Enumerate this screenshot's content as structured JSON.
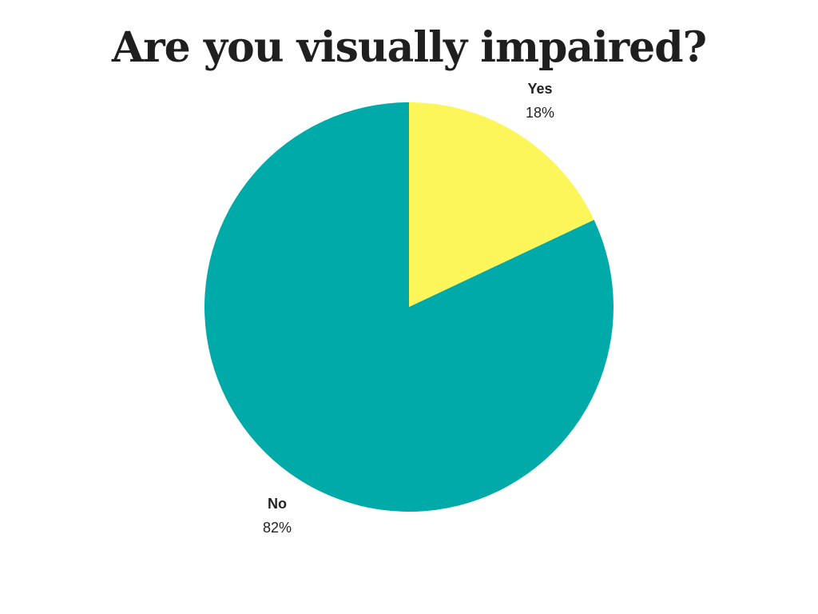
{
  "chart_data": {
    "type": "pie",
    "title": "Are you visually impaired?",
    "slices": [
      {
        "label": "Yes",
        "value": 18,
        "display": "18%",
        "color": "#fdf65a"
      },
      {
        "label": "No",
        "value": 82,
        "display": "82%",
        "color": "#00aaa9"
      }
    ],
    "start": "top",
    "direction": "clockwise",
    "legend": "none"
  }
}
